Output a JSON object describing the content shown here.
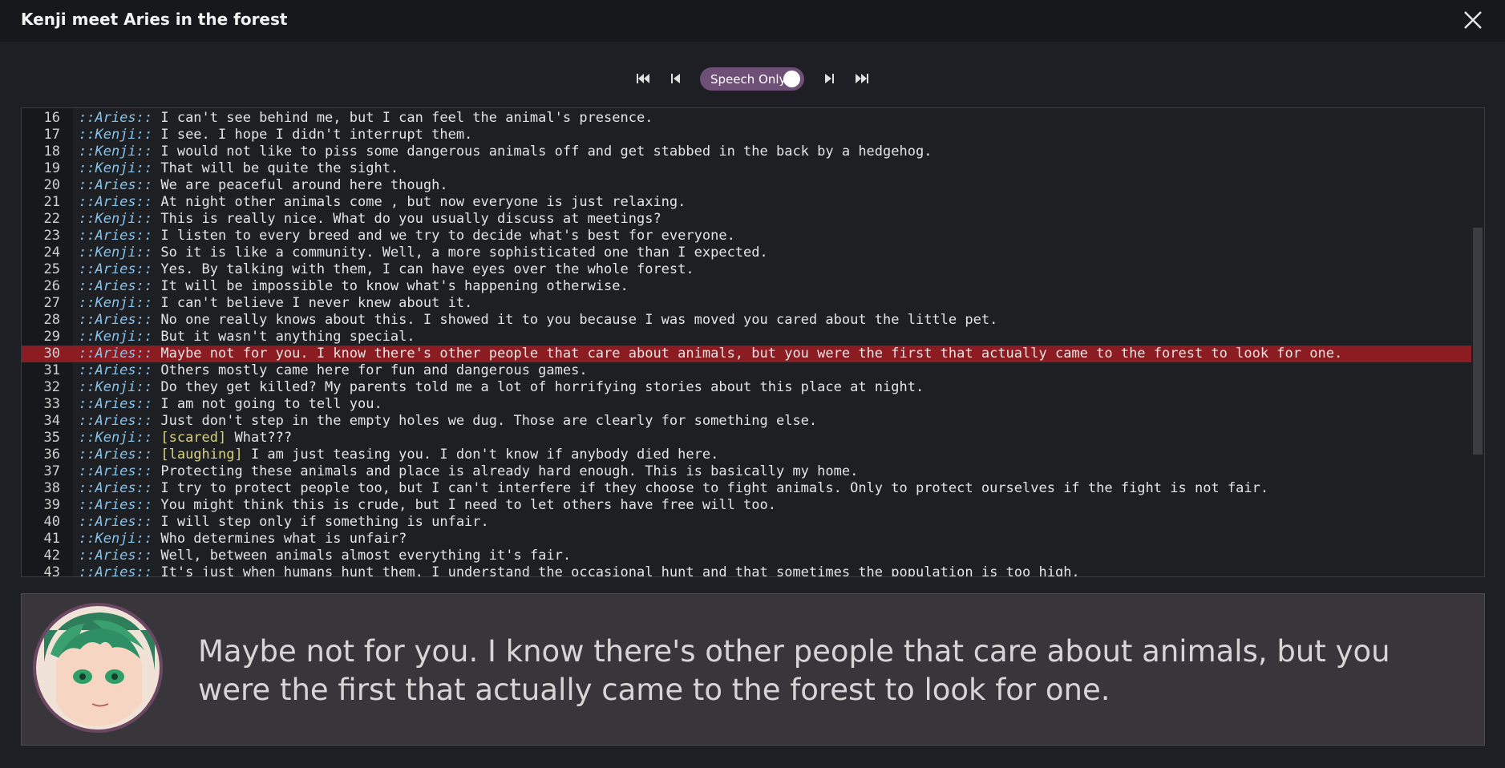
{
  "window": {
    "title": "Kenji meet Aries in the forest"
  },
  "toolbar": {
    "first_icon": "skip-to-start-icon",
    "prev_icon": "step-back-icon",
    "toggle_label": "Speech Only",
    "toggle_on": true,
    "next_icon": "step-forward-icon",
    "last_icon": "skip-to-end-icon"
  },
  "script": {
    "active_line": 30,
    "lines": [
      {
        "n": "16",
        "speaker": "::Aries::",
        "tag": "",
        "text": " I can't see behind me, but I can feel the animal's presence."
      },
      {
        "n": "17",
        "speaker": "::Kenji::",
        "tag": "",
        "text": " I see. I hope I didn't interrupt them."
      },
      {
        "n": "18",
        "speaker": "::Kenji::",
        "tag": "",
        "text": " I would not like to piss some dangerous animals off and get stabbed in the back by a hedgehog."
      },
      {
        "n": "19",
        "speaker": "::Kenji::",
        "tag": "",
        "text": " That will be quite the sight."
      },
      {
        "n": "20",
        "speaker": "::Aries::",
        "tag": "",
        "text": " We are peaceful around here though."
      },
      {
        "n": "21",
        "speaker": "::Aries::",
        "tag": "",
        "text": " At night other animals come , but now everyone is just relaxing."
      },
      {
        "n": "22",
        "speaker": "::Kenji::",
        "tag": "",
        "text": " This is really nice. What do you usually discuss at meetings?"
      },
      {
        "n": "23",
        "speaker": "::Aries::",
        "tag": "",
        "text": " I listen to every breed and we try to decide what's best for everyone."
      },
      {
        "n": "24",
        "speaker": "::Kenji::",
        "tag": "",
        "text": " So it is like a community. Well, a more sophisticated one than I expected."
      },
      {
        "n": "25",
        "speaker": "::Aries::",
        "tag": "",
        "text": " Yes. By talking with them, I can have eyes over the whole forest."
      },
      {
        "n": "26",
        "speaker": "::Aries::",
        "tag": "",
        "text": " It will be impossible to know what's happening otherwise."
      },
      {
        "n": "27",
        "speaker": "::Kenji::",
        "tag": "",
        "text": " I can't believe I never knew about it."
      },
      {
        "n": "28",
        "speaker": "::Aries::",
        "tag": "",
        "text": " No one really knows about this. I showed it to you because I was moved you cared about the little pet."
      },
      {
        "n": "29",
        "speaker": "::Kenji::",
        "tag": "",
        "text": " But it wasn't anything special."
      },
      {
        "n": "30",
        "speaker": "::Aries::",
        "tag": "",
        "text": " Maybe not for you. I know there's other people that care about animals, but you were the first that actually came to the forest to look for one."
      },
      {
        "n": "31",
        "speaker": "::Aries::",
        "tag": "",
        "text": " Others mostly came here for fun and dangerous games."
      },
      {
        "n": "32",
        "speaker": "::Kenji::",
        "tag": "",
        "text": " Do they get killed? My parents told me a lot of horrifying stories about this place at night."
      },
      {
        "n": "33",
        "speaker": "::Aries::",
        "tag": "",
        "text": " I am not going to tell you."
      },
      {
        "n": "34",
        "speaker": "::Aries::",
        "tag": "",
        "text": " Just don't step in the empty holes we dug. Those are clearly for something else."
      },
      {
        "n": "35",
        "speaker": "::Kenji::",
        "tag": " [scared]",
        "text": " What???"
      },
      {
        "n": "36",
        "speaker": "::Aries::",
        "tag": " [laughing]",
        "text": " I am just teasing you. I don't know if anybody died here."
      },
      {
        "n": "37",
        "speaker": "::Aries::",
        "tag": "",
        "text": " Protecting these animals and place is already hard enough. This is basically my home."
      },
      {
        "n": "38",
        "speaker": "::Aries::",
        "tag": "",
        "text": " I try to protect people too, but I can't interfere if they choose to fight animals. Only to protect ourselves if the fight is not fair."
      },
      {
        "n": "39",
        "speaker": "::Aries::",
        "tag": "",
        "text": " You might think this is crude, but I need to let others have free will too."
      },
      {
        "n": "40",
        "speaker": "::Aries::",
        "tag": "",
        "text": " I will step only if something is unfair."
      },
      {
        "n": "41",
        "speaker": "::Kenji::",
        "tag": "",
        "text": " Who determines what is unfair?"
      },
      {
        "n": "42",
        "speaker": "::Aries::",
        "tag": "",
        "text": " Well, between animals almost everything it's fair."
      },
      {
        "n": "43",
        "speaker": "::Aries::",
        "tag": "",
        "text": " It's just when humans hunt them. I understand the occasional hunt and that sometimes the population is too high."
      }
    ]
  },
  "dialog": {
    "portrait": "aries-portrait",
    "text": "Maybe not for you. I know there's other people that care about animals, but you were the first that actually came to the forest to look for one."
  },
  "colors": {
    "speaker": "#86c3ea",
    "emotion": "#d8d27a",
    "active_line": "#8b1c22",
    "toggle": "#6e4f75"
  }
}
